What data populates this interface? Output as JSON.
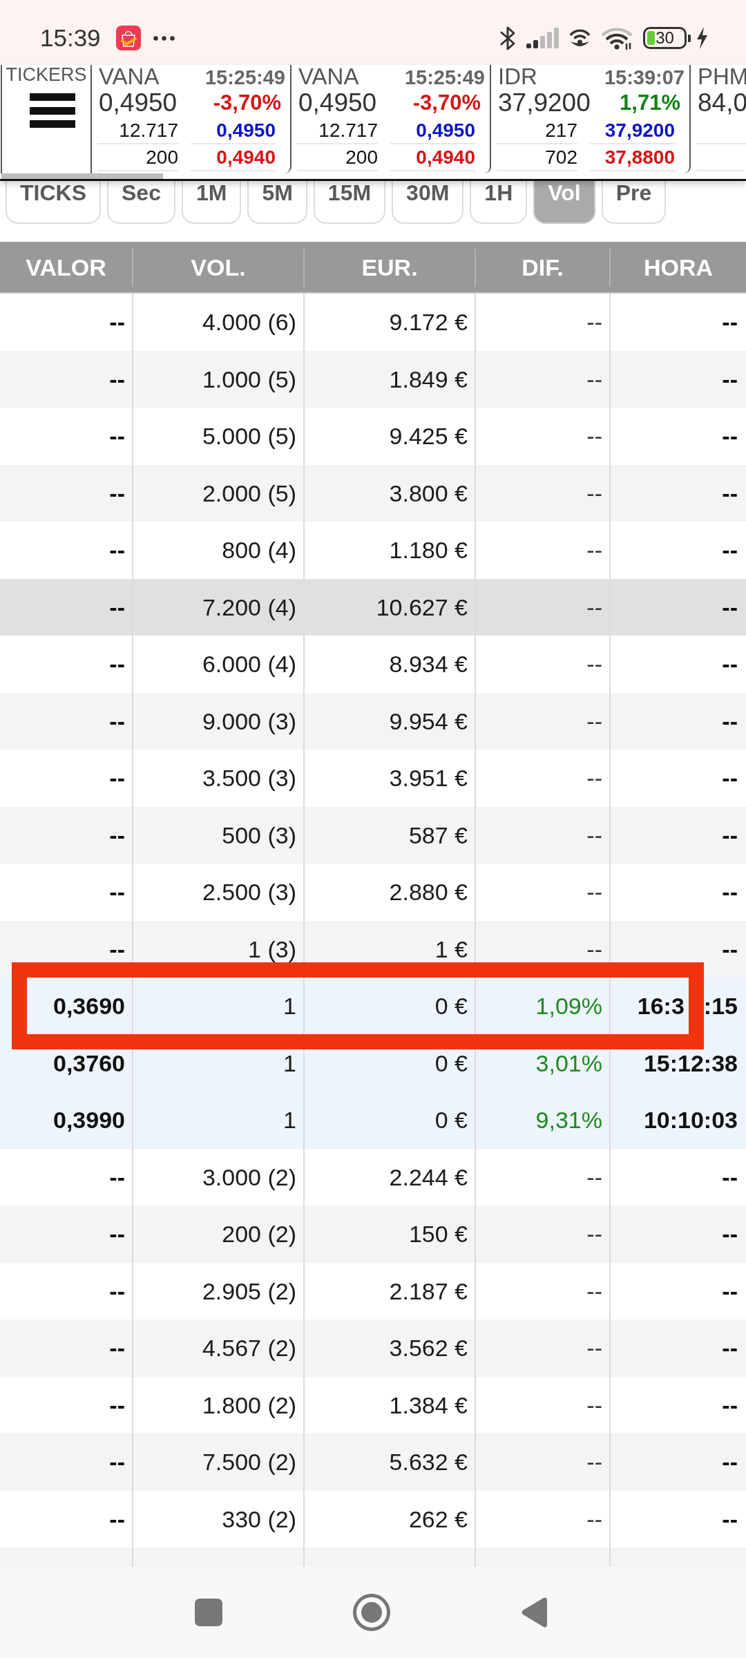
{
  "status_bar": {
    "time": "15:39",
    "battery": "30"
  },
  "tickers": {
    "label": "TICKERS",
    "cards": [
      {
        "symbol": "VANA",
        "time": "15:25:49",
        "price": "0,4950",
        "change": "-3,70%",
        "rising": false,
        "depth": [
          {
            "volume": "12.717",
            "price": "0,4950"
          },
          {
            "volume": "200",
            "price": "0,4940"
          }
        ]
      },
      {
        "symbol": "VANA",
        "time": "15:25:49",
        "price": "0,4950",
        "change": "-3,70%",
        "rising": false,
        "depth": [
          {
            "volume": "12.717",
            "price": "0,4950"
          },
          {
            "volume": "200",
            "price": "0,4940"
          }
        ]
      },
      {
        "symbol": "IDR",
        "time": "15:39:07",
        "price": "37,9200",
        "change": "1,71%",
        "rising": true,
        "depth": [
          {
            "volume": "217",
            "price": "37,9200"
          },
          {
            "volume": "702",
            "price": "37,8800"
          }
        ]
      },
      {
        "symbol": "PHM",
        "price": "84,0"
      }
    ]
  },
  "tabs": [
    {
      "label": "TICKS",
      "selected": false
    },
    {
      "label": "Sec",
      "selected": false
    },
    {
      "label": "1M",
      "selected": false
    },
    {
      "label": "5M",
      "selected": false
    },
    {
      "label": "15M",
      "selected": false
    },
    {
      "label": "30M",
      "selected": false
    },
    {
      "label": "1H",
      "selected": false
    },
    {
      "label": "Vol",
      "selected": true
    },
    {
      "label": "Pre",
      "selected": false
    }
  ],
  "table": {
    "columns": [
      "VALOR",
      "VOL.",
      "EUR.",
      "DIF.",
      "HORA"
    ],
    "rows": [
      {
        "kind": "summary",
        "selected": false,
        "marked": false,
        "cells": [
          "--",
          "4.000 (6)",
          "9.172 €",
          "--",
          "--"
        ]
      },
      {
        "kind": "summary",
        "selected": false,
        "marked": false,
        "cells": [
          "--",
          "1.000 (5)",
          "1.849 €",
          "--",
          "--"
        ]
      },
      {
        "kind": "summary",
        "selected": false,
        "marked": false,
        "cells": [
          "--",
          "5.000 (5)",
          "9.425 €",
          "--",
          "--"
        ]
      },
      {
        "kind": "summary",
        "selected": false,
        "marked": false,
        "cells": [
          "--",
          "2.000 (5)",
          "3.800 €",
          "--",
          "--"
        ]
      },
      {
        "kind": "summary",
        "selected": false,
        "marked": false,
        "cells": [
          "--",
          "800 (4)",
          "1.180 €",
          "--",
          "--"
        ]
      },
      {
        "kind": "summary",
        "selected": true,
        "marked": false,
        "cells": [
          "--",
          "7.200 (4)",
          "10.627 €",
          "--",
          "--"
        ]
      },
      {
        "kind": "summary",
        "selected": false,
        "marked": false,
        "cells": [
          "--",
          "6.000 (4)",
          "8.934 €",
          "--",
          "--"
        ]
      },
      {
        "kind": "summary",
        "selected": false,
        "marked": false,
        "cells": [
          "--",
          "9.000 (3)",
          "9.954 €",
          "--",
          "--"
        ]
      },
      {
        "kind": "summary",
        "selected": false,
        "marked": false,
        "cells": [
          "--",
          "3.500 (3)",
          "3.951 €",
          "--",
          "--"
        ]
      },
      {
        "kind": "summary",
        "selected": false,
        "marked": false,
        "cells": [
          "--",
          "500 (3)",
          "587 €",
          "--",
          "--"
        ]
      },
      {
        "kind": "summary",
        "selected": false,
        "marked": false,
        "cells": [
          "--",
          "2.500 (3)",
          "2.880 €",
          "--",
          "--"
        ]
      },
      {
        "kind": "summary",
        "selected": false,
        "marked": false,
        "cells": [
          "--",
          "1 (3)",
          "1 €",
          "--",
          "--"
        ]
      },
      {
        "kind": "trade",
        "selected": false,
        "marked": true,
        "cells": [
          "0,3690",
          "1",
          "0 €",
          "1,09%",
          [
            "16:3",
            ":15"
          ]
        ]
      },
      {
        "kind": "trade",
        "selected": false,
        "marked": false,
        "cells": [
          "0,3760",
          "1",
          "0 €",
          "3,01%",
          "15:12:38"
        ]
      },
      {
        "kind": "trade",
        "selected": false,
        "marked": false,
        "cells": [
          "0,3990",
          "1",
          "0 €",
          "9,31%",
          "10:10:03"
        ]
      },
      {
        "kind": "summary",
        "selected": false,
        "marked": false,
        "cells": [
          "--",
          "3.000 (2)",
          "2.244 €",
          "--",
          "--"
        ]
      },
      {
        "kind": "summary",
        "selected": false,
        "marked": false,
        "cells": [
          "--",
          "200 (2)",
          "150 €",
          "--",
          "--"
        ]
      },
      {
        "kind": "summary",
        "selected": false,
        "marked": false,
        "cells": [
          "--",
          "2.905 (2)",
          "2.187 €",
          "--",
          "--"
        ]
      },
      {
        "kind": "summary",
        "selected": false,
        "marked": false,
        "cells": [
          "--",
          "4.567 (2)",
          "3.562 €",
          "--",
          "--"
        ]
      },
      {
        "kind": "summary",
        "selected": false,
        "marked": false,
        "cells": [
          "--",
          "1.800 (2)",
          "1.384 €",
          "--",
          "--"
        ]
      },
      {
        "kind": "summary",
        "selected": false,
        "marked": false,
        "cells": [
          "--",
          "7.500 (2)",
          "5.632 €",
          "--",
          "--"
        ]
      },
      {
        "kind": "summary",
        "selected": false,
        "marked": false,
        "cells": [
          "--",
          "330 (2)",
          "262 €",
          "--",
          "--"
        ]
      }
    ]
  }
}
